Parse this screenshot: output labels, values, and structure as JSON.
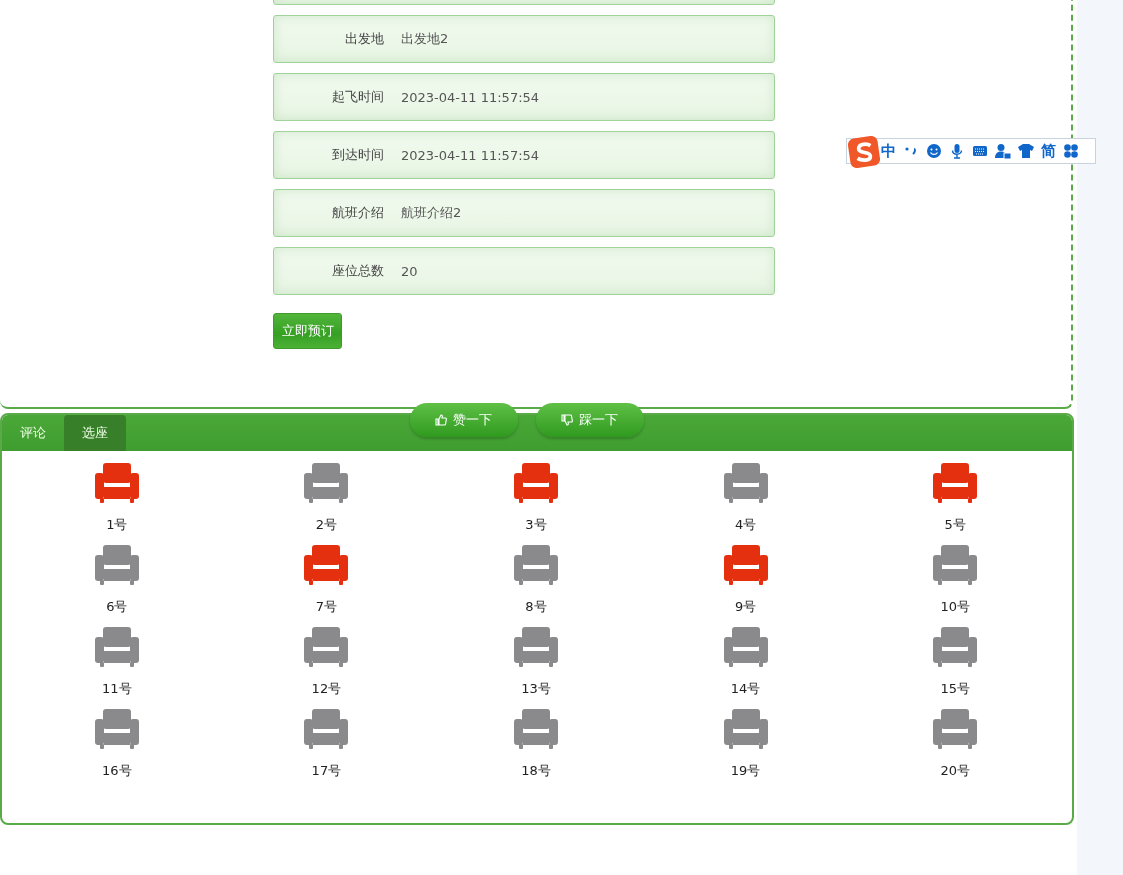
{
  "details": [
    {
      "label": "出发地",
      "value": "出发地2"
    },
    {
      "label": "起飞时间",
      "value": "2023-04-11 11:57:54"
    },
    {
      "label": "到达时间",
      "value": "2023-04-11 11:57:54"
    },
    {
      "label": "航班介绍",
      "value": "航班介绍2"
    },
    {
      "label": "座位总数",
      "value": "20"
    }
  ],
  "book_button": "立即预订",
  "vote_buttons": [
    {
      "kind": "like",
      "label": "赞一下"
    },
    {
      "kind": "dislike",
      "label": "踩一下"
    }
  ],
  "tabs": [
    {
      "label": "评论",
      "selected": false
    },
    {
      "label": "选座",
      "selected": true
    }
  ],
  "seats": [
    {
      "label": "1号",
      "booked": true
    },
    {
      "label": "2号",
      "booked": false
    },
    {
      "label": "3号",
      "booked": true
    },
    {
      "label": "4号",
      "booked": false
    },
    {
      "label": "5号",
      "booked": true
    },
    {
      "label": "6号",
      "booked": false
    },
    {
      "label": "7号",
      "booked": true
    },
    {
      "label": "8号",
      "booked": false
    },
    {
      "label": "9号",
      "booked": true
    },
    {
      "label": "10号",
      "booked": false
    },
    {
      "label": "11号",
      "booked": false
    },
    {
      "label": "12号",
      "booked": false
    },
    {
      "label": "13号",
      "booked": false
    },
    {
      "label": "14号",
      "booked": false
    },
    {
      "label": "15号",
      "booked": false
    },
    {
      "label": "16号",
      "booked": false
    },
    {
      "label": "17号",
      "booked": false
    },
    {
      "label": "18号",
      "booked": false
    },
    {
      "label": "19号",
      "booked": false
    },
    {
      "label": "20号",
      "booked": false
    }
  ],
  "ime_toolbar": {
    "mode": "中",
    "script": "简"
  }
}
